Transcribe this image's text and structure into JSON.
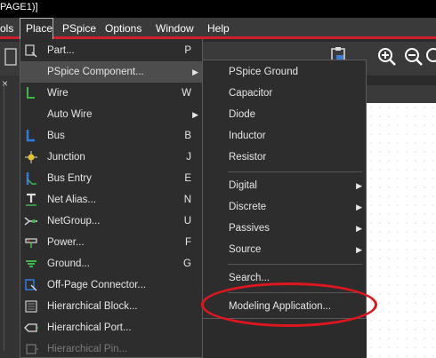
{
  "window": {
    "title": "PAGE1)]"
  },
  "menubar": [
    "ols",
    "Place",
    "PSpice",
    "Options",
    "Window",
    "Help"
  ],
  "place_menu": [
    {
      "label": "Part...",
      "shortcut": "P",
      "icon": "part-icon"
    },
    {
      "label": "PSpice Component...",
      "shortcut": "",
      "icon": "",
      "submenu": true
    },
    {
      "label": "Wire",
      "shortcut": "W",
      "icon": "wire-icon"
    },
    {
      "label": "Auto Wire",
      "shortcut": "",
      "icon": "",
      "submenu": true
    },
    {
      "label": "Bus",
      "shortcut": "B",
      "icon": "bus-icon"
    },
    {
      "label": "Junction",
      "shortcut": "J",
      "icon": "junction-icon"
    },
    {
      "label": "Bus Entry",
      "shortcut": "E",
      "icon": "bus-entry-icon"
    },
    {
      "label": "Net Alias...",
      "shortcut": "N",
      "icon": "net-alias-icon"
    },
    {
      "label": "NetGroup...",
      "shortcut": "U",
      "icon": "netgroup-icon"
    },
    {
      "label": "Power...",
      "shortcut": "F",
      "icon": "power-icon"
    },
    {
      "label": "Ground...",
      "shortcut": "G",
      "icon": "ground-icon"
    },
    {
      "label": "Off-Page Connector...",
      "shortcut": "",
      "icon": "off-page-connector-icon"
    },
    {
      "label": "Hierarchical Block...",
      "shortcut": "",
      "icon": "hierarchical-block-icon"
    },
    {
      "label": "Hierarchical Port...",
      "shortcut": "",
      "icon": "hierarchical-port-icon"
    },
    {
      "label": "Hierarchical Pin...",
      "shortcut": "",
      "icon": "hierarchical-pin-icon",
      "disabled": true
    }
  ],
  "pspice_submenu": [
    {
      "label": "PSpice Ground"
    },
    {
      "label": "Capacitor"
    },
    {
      "label": "Diode"
    },
    {
      "label": "Inductor"
    },
    {
      "label": "Resistor"
    },
    {
      "label": "Digital",
      "submenu": true
    },
    {
      "label": "Discrete",
      "submenu": true
    },
    {
      "label": "Passives",
      "submenu": true
    },
    {
      "label": "Source",
      "submenu": true
    },
    {
      "label": "Search..."
    },
    {
      "label": "Modeling Application..."
    }
  ],
  "colors": {
    "accent": "#d01f2c",
    "highlight_ellipse": "#e0161e"
  }
}
